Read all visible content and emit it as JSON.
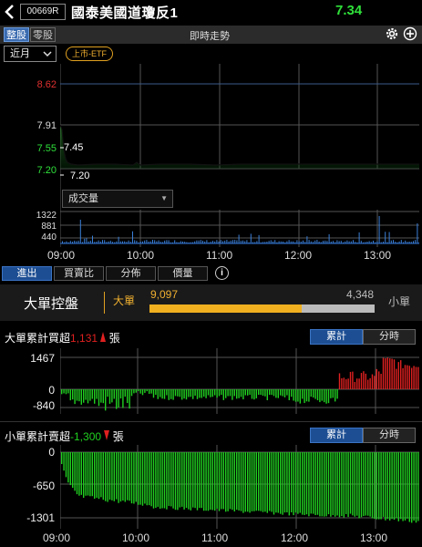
{
  "header": {
    "code": "00669R",
    "name": "國泰美國道瓊反1",
    "price": "7.34"
  },
  "tabs": {
    "whole": "整股",
    "odd": "零股"
  },
  "chart_title": "即時走勢",
  "period": {
    "selected": "近月"
  },
  "badge": "上市-ETF",
  "main_chart": {
    "y_labels": [
      "8.62",
      "7.91",
      "7.55",
      "7.20"
    ],
    "annotations": [
      "7.45",
      "7.20"
    ],
    "volume_select": "成交量",
    "volume_labels": [
      "1322",
      "881",
      "440"
    ],
    "time_labels": [
      "09:00",
      "10:00",
      "11:00",
      "12:00",
      "13:00"
    ]
  },
  "subtabs": [
    "進出",
    "買賣比",
    "分佈",
    "價量"
  ],
  "info_icon": "i",
  "big_control": {
    "title": "大單控盤",
    "big_label": "大單",
    "big_value": "9,097",
    "small_value": "4,348",
    "small_label": "小單",
    "big_ratio": 0.677
  },
  "big_panel": {
    "title_prefix": "大單累計買超",
    "value": "1,131",
    "suffix": "張",
    "toggle_cum": "累計",
    "toggle_min": "分時",
    "y_labels": [
      "1467",
      "0",
      "-840"
    ]
  },
  "small_panel": {
    "title_prefix": "小單累計賣超",
    "value": "-1,300",
    "suffix": "張",
    "toggle_cum": "累計",
    "toggle_min": "分時",
    "y_labels": [
      "0",
      "-650",
      "-1301"
    ],
    "time_labels": [
      "09:00",
      "10:00",
      "11:00",
      "12:00",
      "13:00"
    ]
  },
  "colors": {
    "up": "#e02020",
    "down": "#20d020",
    "accent": "#f0b020",
    "price": "#2fe03a"
  }
}
